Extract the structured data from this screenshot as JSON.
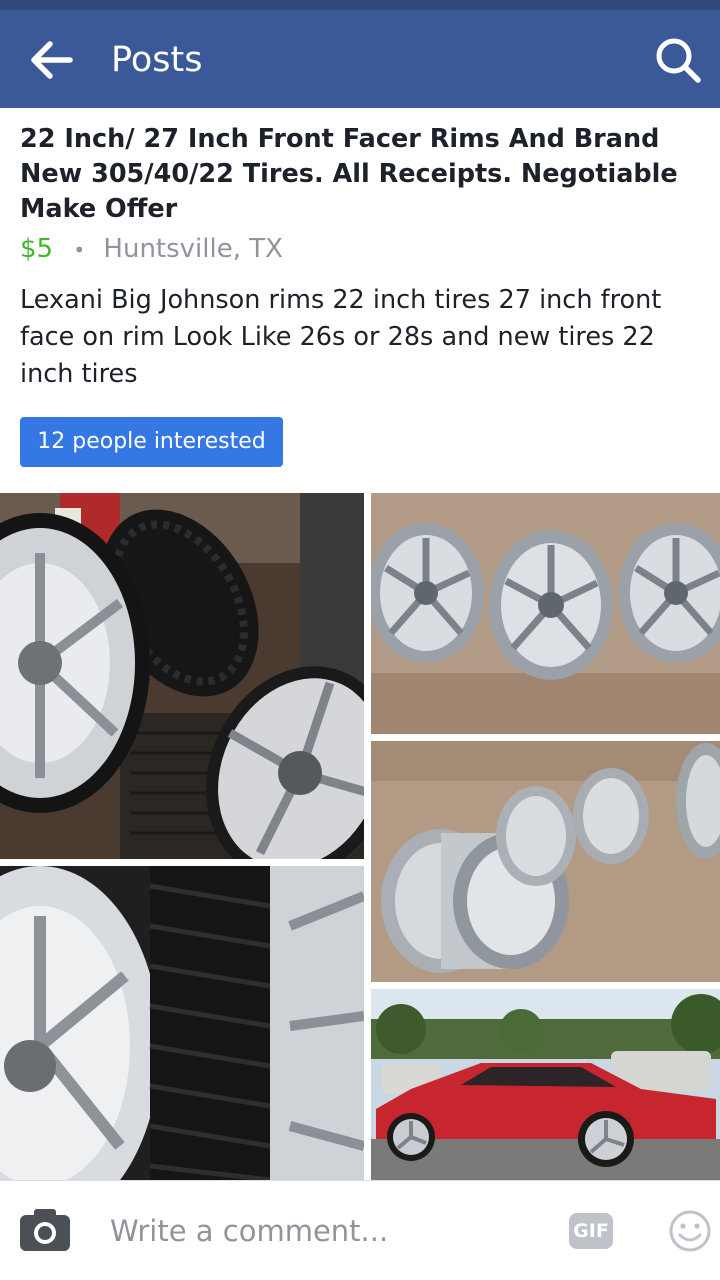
{
  "header": {
    "title": "Posts",
    "back_icon": "arrow-left-icon",
    "search_icon": "search-icon",
    "bar_color": "#3b5998"
  },
  "post": {
    "title": "22 Inch/ 27 Inch Front Facer Rims And Brand New 305/40/22 Tires. All Receipts. Negotiable Make Offer",
    "price": "$5",
    "separator": "•",
    "location": "Huntsville, TX",
    "description": "Lexani Big Johnson rims 22 inch tires 27 inch front face on rim Look Like 26s or 28s and new tires 22 inch tires",
    "interested_label": "12 people interested",
    "price_color": "#42b72a",
    "button_color": "#3578e5"
  },
  "photos": [
    {
      "name": "photo-rims-with-tires-in-shop"
    },
    {
      "name": "photo-three-rims-on-ground"
    },
    {
      "name": "photo-rims-side-view"
    },
    {
      "name": "photo-tire-closeup"
    },
    {
      "name": "photo-red-car-with-rims"
    }
  ],
  "comment_bar": {
    "placeholder": "Write a comment...",
    "gif_label": "GIF",
    "camera_icon": "camera-icon",
    "emoji_icon": "smiley-icon"
  }
}
